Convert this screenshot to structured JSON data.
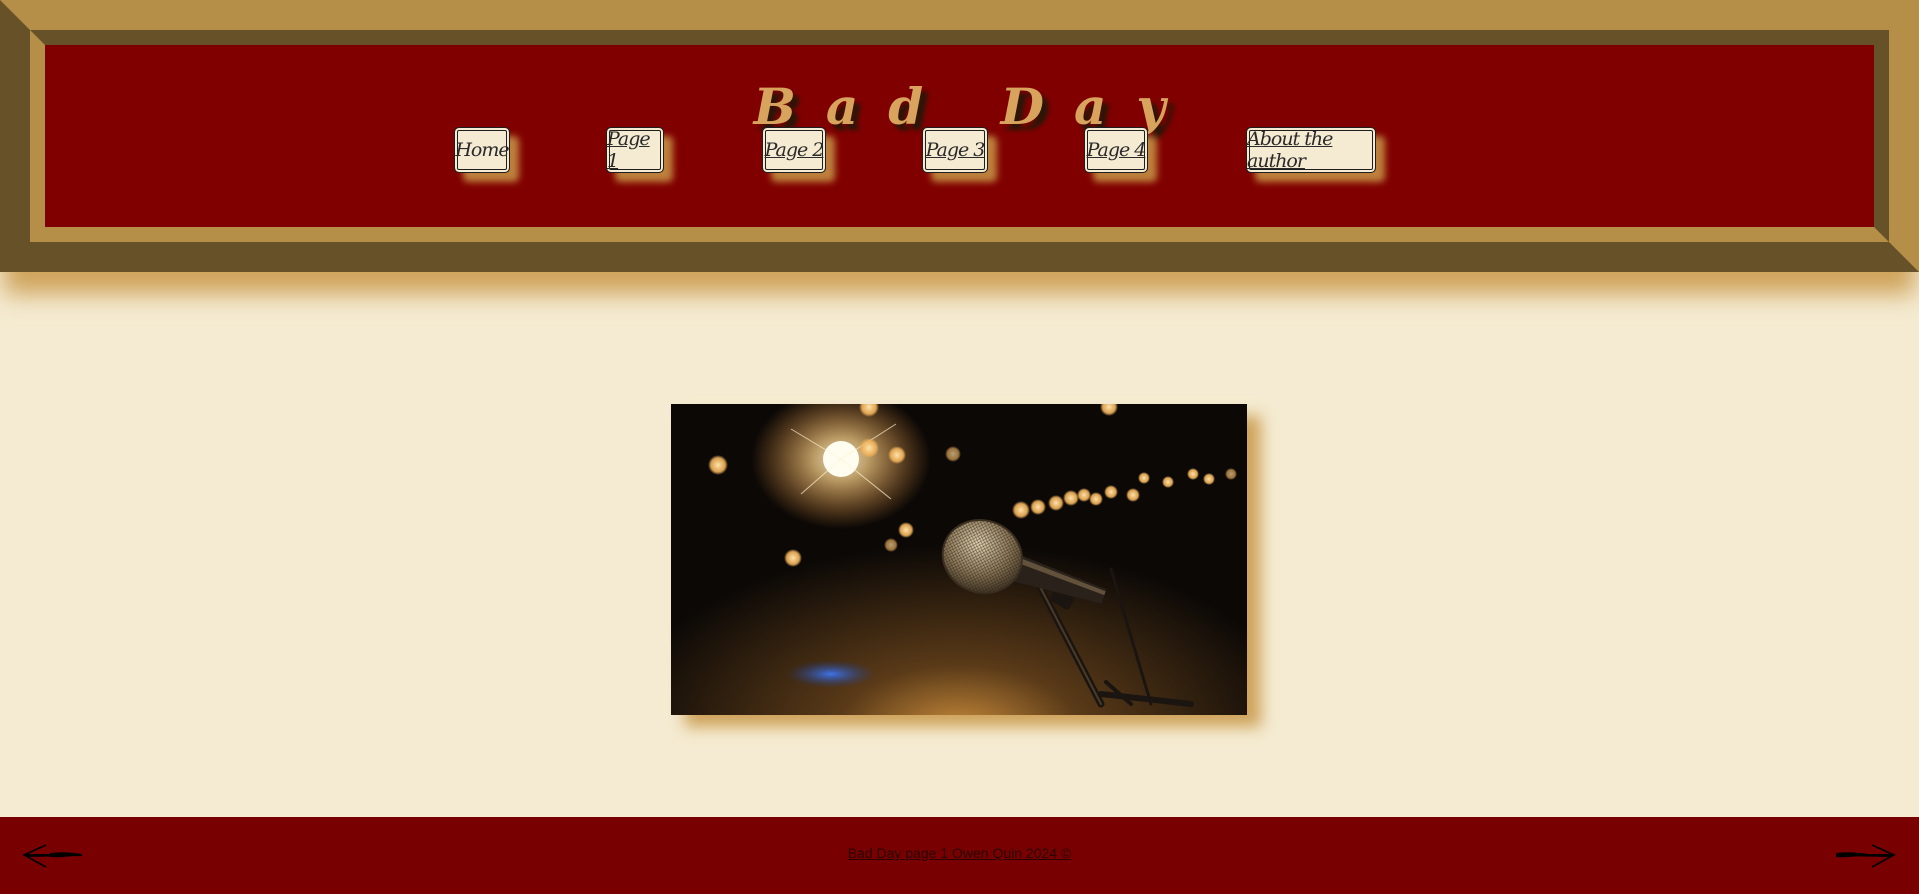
{
  "header": {
    "title": "Bad Day"
  },
  "nav": {
    "home": "Home",
    "page1": "Page 1",
    "page2": "Page 2",
    "page3": "Page 3",
    "page4": "Page 4",
    "about": "About the author"
  },
  "footer": {
    "text": "Bad Day page 1 Owen Quin 2024 ©",
    "prev_icon": "arrow-left-icon",
    "next_icon": "arrow-right-icon"
  },
  "colors": {
    "background": "#f5ebd2",
    "header_red": "#800000",
    "frame_gold": "#b58e47",
    "frame_dark": "#675129",
    "title_gold": "#d8a35c",
    "footer_red": "#780000"
  }
}
